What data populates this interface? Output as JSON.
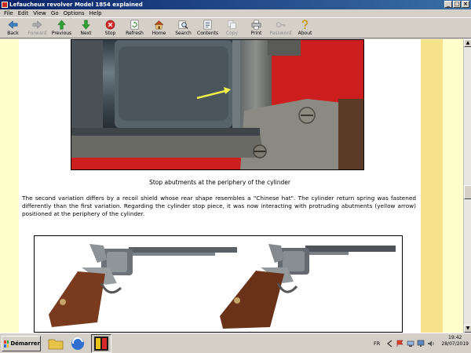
{
  "window": {
    "title": "Lefaucheux revolver Model 1854 explained"
  },
  "menu": [
    "File",
    "Edit",
    "View",
    "Go",
    "Options",
    "Help"
  ],
  "toolbar": {
    "back": "Back",
    "forward": "Forward",
    "previous": "Previous",
    "next": "Next",
    "stop": "Stop",
    "refresh": "Refresh",
    "home": "Home",
    "search": "Search",
    "contents": "Contents",
    "copy": "Copy",
    "print": "Print",
    "password": "Password",
    "about": "About"
  },
  "content": {
    "caption": "Stop abutments at the periphery of the cylinder",
    "paragraph": "The second variation differs by a recoil shield whose rear shape resembles a \"Chinese hat\". The cylinder return spring was fastened differently than the first variation. Regarding the cylinder stop piece, it was now interacting with protruding abutments (yellow arrow) positioned at the periphery of the cylinder."
  },
  "taskbar": {
    "start": "Démarrer",
    "language": "FR",
    "time": "19:42",
    "date": "28/07/2019"
  },
  "colors": {
    "title_bar": "#0a246a",
    "page_background": "#ffffcc",
    "accent_band": "#f7e28c",
    "photo_red": "#cc1e1e",
    "arrow_yellow": "#f2f24a"
  }
}
